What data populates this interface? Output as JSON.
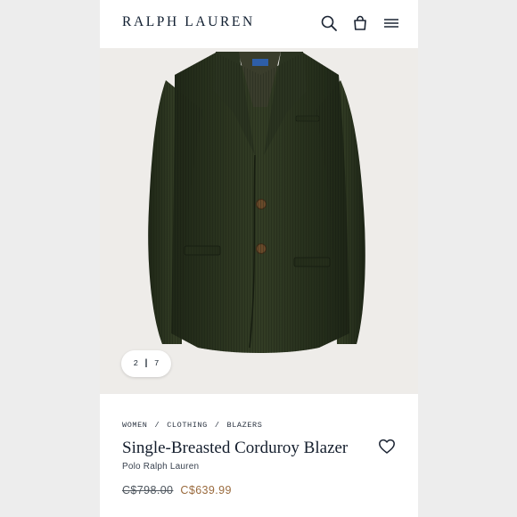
{
  "header": {
    "brand": "RALPH LAUREN",
    "icons": [
      "search-icon",
      "shopping-bag-icon",
      "hamburger-menu-icon"
    ]
  },
  "gallery": {
    "current": "2",
    "separator": "|",
    "total": "7",
    "product_color": "#2c3520"
  },
  "breadcrumb": {
    "items": [
      "WOMEN",
      "CLOTHING",
      "BLAZERS"
    ],
    "separator": "/"
  },
  "product": {
    "title": "Single-Breasted Corduroy Blazer",
    "brand": "Polo Ralph Lauren",
    "original_price": "C$798.00",
    "sale_price": "C$639.99",
    "sale_color": "#9a6b3e"
  }
}
